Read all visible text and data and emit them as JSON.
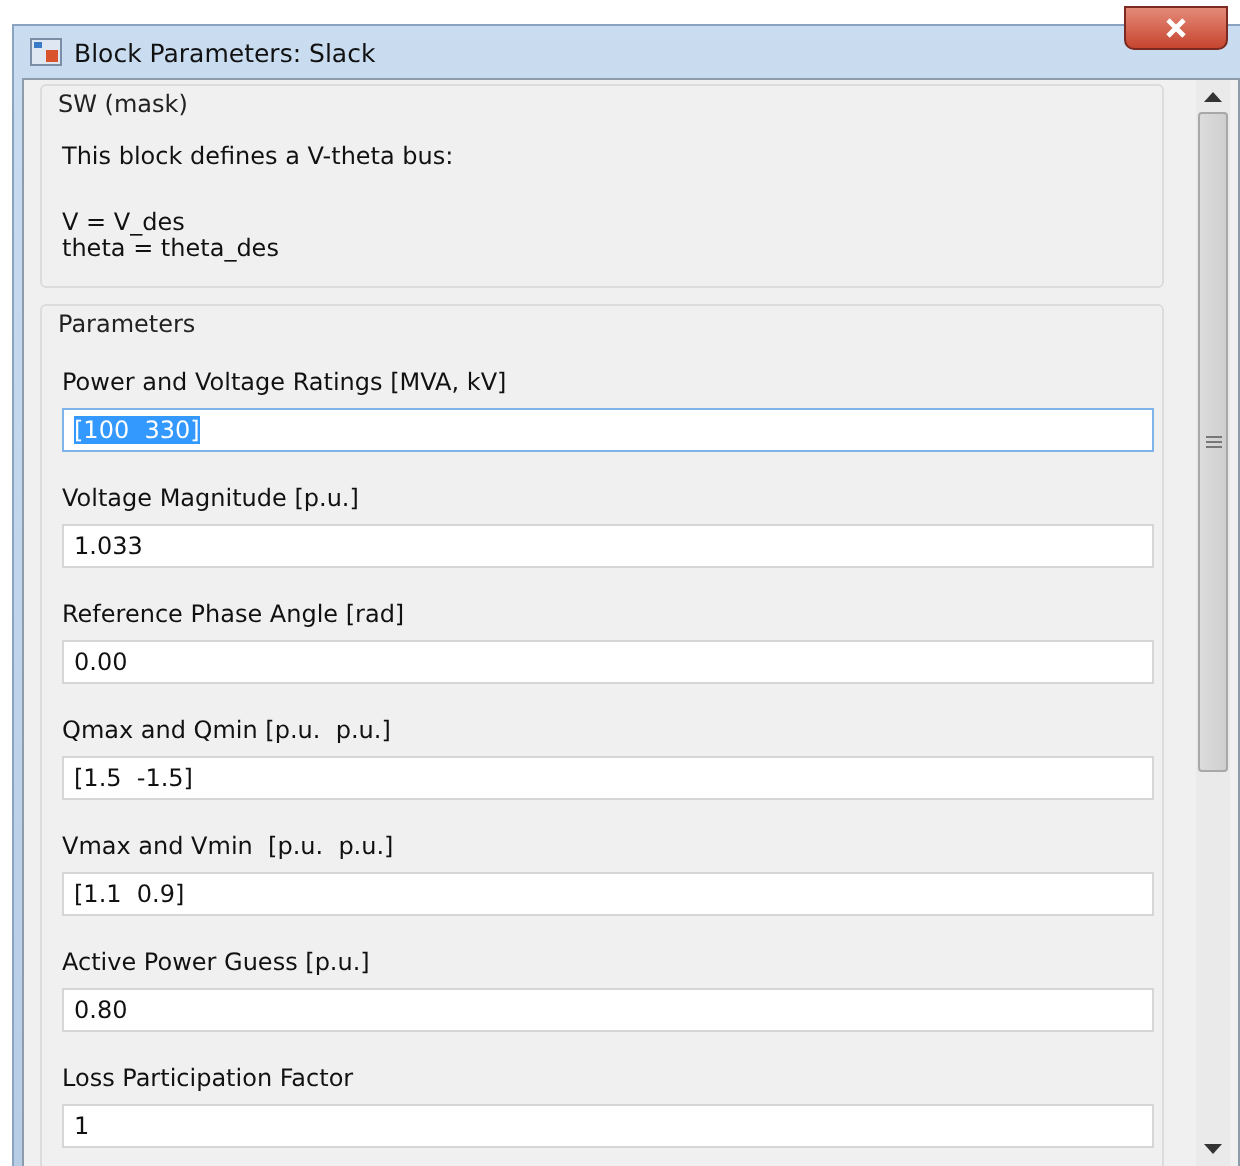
{
  "window": {
    "title": "Block Parameters: Slack"
  },
  "mask": {
    "title": "SW (mask)",
    "description": "This block defines a V-theta bus:",
    "equations": [
      "V = V_des",
      "theta = theta_des"
    ]
  },
  "parameters": {
    "title": "Parameters",
    "fields": [
      {
        "label": "Power and Voltage Ratings [MVA, kV]",
        "value": "[100  330]",
        "focused": true
      },
      {
        "label": "Voltage Magnitude [p.u.]",
        "value": "1.033",
        "focused": false
      },
      {
        "label": "Reference Phase Angle [rad]",
        "value": "0.00",
        "focused": false
      },
      {
        "label": "Qmax and Qmin [p.u.  p.u.]",
        "value": "[1.5  -1.5]",
        "focused": false
      },
      {
        "label": "Vmax and Vmin  [p.u.  p.u.]",
        "value": "[1.1  0.9]",
        "focused": false
      },
      {
        "label": "Active Power Guess [p.u.]",
        "value": "0.80",
        "focused": false
      },
      {
        "label": "Loss Participation Factor",
        "value": "1",
        "focused": false
      }
    ]
  }
}
